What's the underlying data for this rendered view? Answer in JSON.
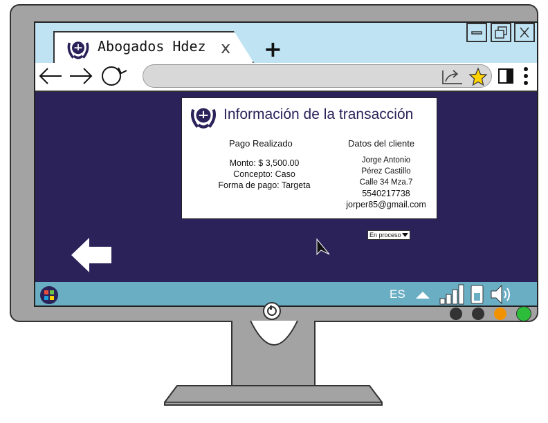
{
  "browser": {
    "tab_title": "Abogados  Hdez",
    "tab_close": "x",
    "new_tab": "+"
  },
  "card": {
    "title": "Información de la transacción",
    "payment": {
      "heading": "Pago Realizado",
      "amount": "Monto: $ 3,500.00",
      "concept": "Concepto: Caso",
      "method": "Forma de pago: Targeta"
    },
    "client": {
      "heading": "Datos del cliente",
      "first_name": "Jorge Antonio",
      "last_name": "Pérez Castillo",
      "address": "Calle 34 Mza.7",
      "phone": "5540217738",
      "email": "jorper85@gmail.com"
    }
  },
  "status_dropdown": {
    "selected": "En proceso"
  },
  "taskbar": {
    "language": "ES"
  },
  "colors": {
    "page_background": "#2a2259",
    "titlebar": "#bfe3f3",
    "taskbar": "#6aaec4",
    "monitor": "#a3a3a3",
    "star": "#ffd200",
    "led_orange": "#f39200",
    "led_green": "#2ebd3a"
  },
  "icons": [
    "law-logo-icon",
    "back-arrow-icon",
    "forward-arrow-icon",
    "refresh-icon",
    "share-icon",
    "star-icon",
    "sidebar-icon",
    "menu-dots-icon",
    "start-icon",
    "triangle-up-icon",
    "signal-icon",
    "battery-icon",
    "speaker-icon",
    "cursor-icon",
    "back-page-arrow-icon",
    "power-icon"
  ]
}
